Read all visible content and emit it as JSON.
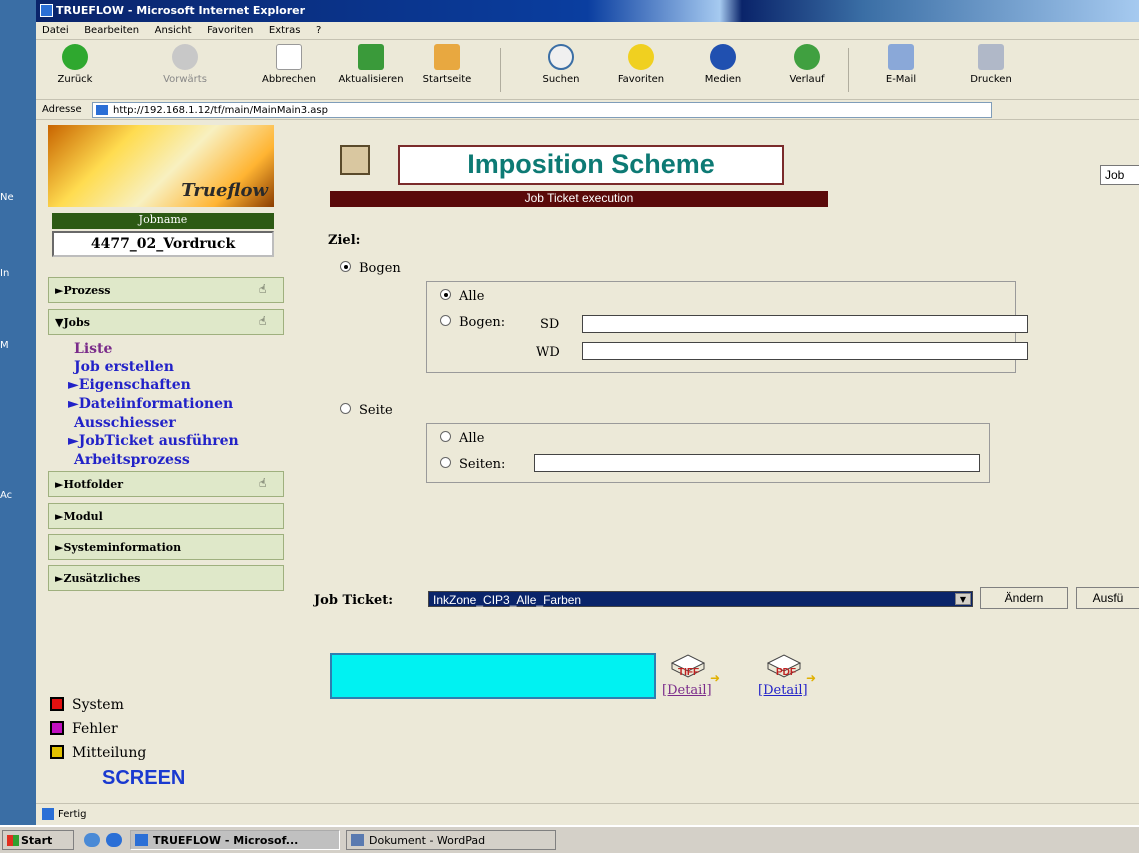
{
  "window": {
    "title": "TRUEFLOW - Microsoft Internet Explorer"
  },
  "desktop": {
    "labels": [
      "Ne",
      "In",
      "M",
      "Ac"
    ]
  },
  "menubar": [
    "Datei",
    "Bearbeiten",
    "Ansicht",
    "Favoriten",
    "Extras",
    "?"
  ],
  "toolbar": {
    "back": "Zurück",
    "forward": "Vorwärts",
    "stop": "Abbrechen",
    "refresh": "Aktualisieren",
    "home": "Startseite",
    "search": "Suchen",
    "favorites": "Favoriten",
    "media": "Medien",
    "history": "Verlauf",
    "mail": "E-Mail",
    "print": "Drucken"
  },
  "address": {
    "label": "Adresse",
    "value": "http://192.168.1.12/tf/main/MainMain3.asp"
  },
  "nav": {
    "logo_text": "Trueflow",
    "jobname_header": "Jobname",
    "jobname_value": "4477_02_Vordruck",
    "sections": [
      {
        "label": "►Prozess",
        "hand": "☝"
      },
      {
        "label": "▼Jobs",
        "hand": "☝"
      },
      {
        "label": "►Hotfolder",
        "hand": "☝"
      },
      {
        "label": "►Modul"
      },
      {
        "label": "►Systeminformation"
      },
      {
        "label": "►Zusätzliches"
      }
    ],
    "jobs_items": [
      "Liste",
      "Job erstellen",
      "►Eigenschaften",
      "►Dateiinformationen",
      "Ausschiesser",
      "►JobTicket ausführen",
      "Arbeitsprozess"
    ],
    "legend": [
      {
        "label": "System",
        "color": "#e01010"
      },
      {
        "label": "Fehler",
        "color": "#c010c0"
      },
      {
        "label": "Mitteilung",
        "color": "#e0c000"
      }
    ],
    "brand": "SCREEN"
  },
  "main": {
    "title": "Imposition Scheme",
    "subtitle": "Job Ticket execution",
    "top_button": "Job",
    "ziel_label": "Ziel:",
    "bogen": {
      "label": "Bogen",
      "selected": true
    },
    "bogen_alle": {
      "label": "Alle",
      "selected": true
    },
    "bogen_bogen": {
      "label": "Bogen:",
      "selected": false
    },
    "sd_label": "SD",
    "wd_label": "WD",
    "seite": {
      "label": "Seite",
      "selected": false
    },
    "seite_alle": {
      "label": "Alle",
      "selected": false
    },
    "seite_seiten": {
      "label": "Seiten:",
      "selected": false
    },
    "job_ticket_label": "Job Ticket:",
    "job_ticket_value": "InkZone_CIP3_Alle_Farben",
    "change_button": "Ändern",
    "execute_button": "Ausfü",
    "flow": [
      {
        "icon_text": "TIFF",
        "detail": "[Detail]",
        "detail_color": "#7a2b8a"
      },
      {
        "icon_text": "PDF",
        "detail": "[Detail]",
        "detail_color": "#2222c8"
      }
    ]
  },
  "status": {
    "text": "Fertig"
  },
  "taskbar": {
    "start": "Start",
    "tasks": [
      "TRUEFLOW - Microsof...",
      "Dokument - WordPad"
    ]
  },
  "colors": {
    "cyan_panel": "#00f2f2",
    "banner_text": "#0d7a74",
    "subtitle_bg": "#5a0a0a"
  }
}
